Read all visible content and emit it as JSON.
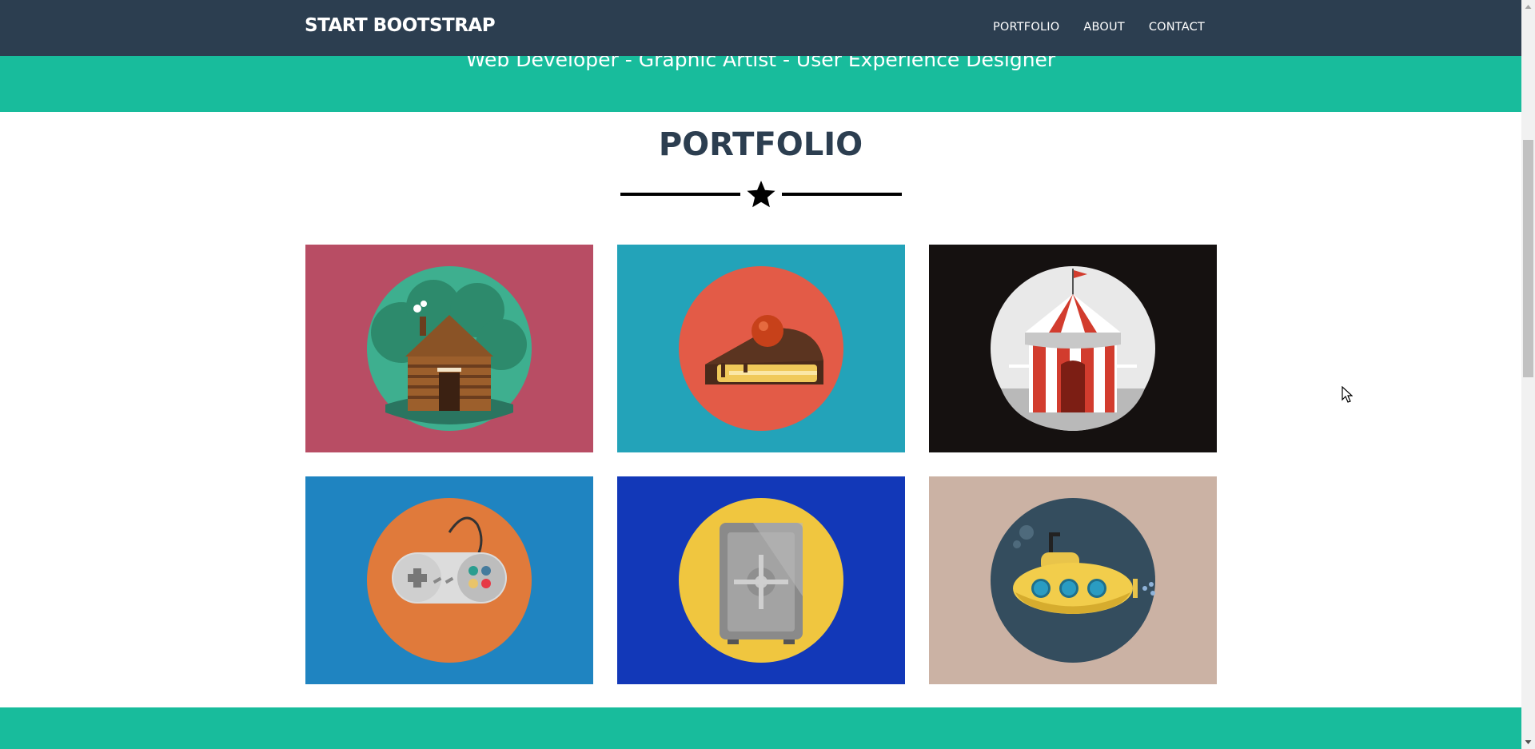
{
  "navbar": {
    "brand": "START BOOTSTRAP",
    "links": [
      {
        "label": "PORTFOLIO"
      },
      {
        "label": "ABOUT"
      },
      {
        "label": "CONTACT"
      }
    ]
  },
  "header": {
    "subtitle": "Web Developer - Graphic Artist - User Experience Designer"
  },
  "portfolio": {
    "title": "PORTFOLIO",
    "divider_icon": "star-icon",
    "items": [
      {
        "icon": "cabin-icon",
        "background": "#b84d64",
        "circle": "#3eaf8f"
      },
      {
        "icon": "cake-icon",
        "background": "#23a3b9",
        "circle": "#e35b47"
      },
      {
        "icon": "circus-tent-icon",
        "background": "#151110",
        "circle": "#e9e9e9"
      },
      {
        "icon": "game-controller-icon",
        "background": "#1f84c1",
        "circle": "#e07a3b"
      },
      {
        "icon": "safe-icon",
        "background": "#1238b8",
        "circle": "#f0c63f"
      },
      {
        "icon": "submarine-icon",
        "background": "#cbb2a4",
        "circle": "#344d5e"
      }
    ]
  },
  "colors": {
    "navbar": "#2c3e50",
    "accent": "#18bc9c",
    "text_dark": "#2c3e50"
  }
}
